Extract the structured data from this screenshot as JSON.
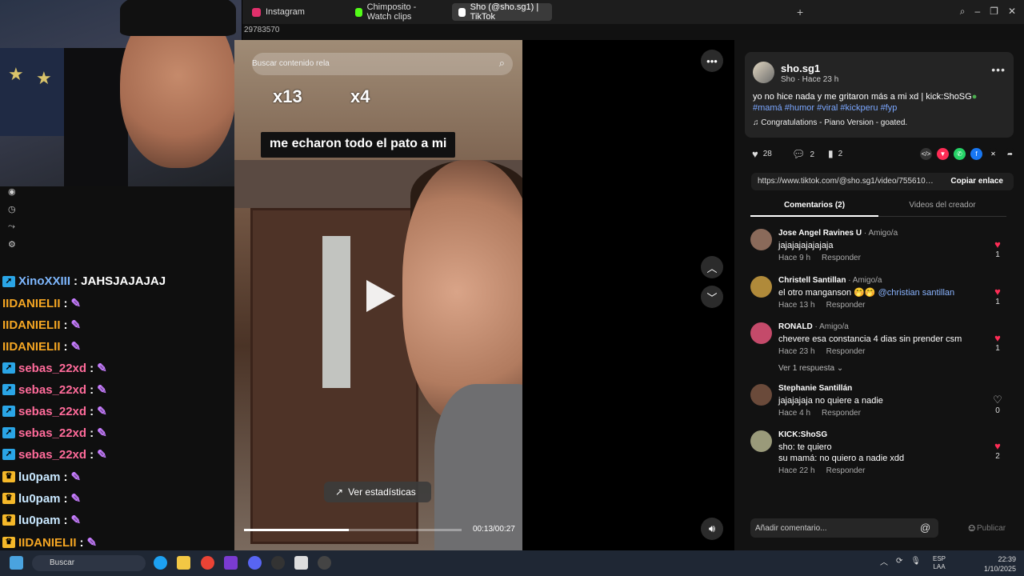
{
  "browser": {
    "tabs": [
      {
        "label": "Instagram",
        "color": "#e1306c"
      },
      {
        "label": "Chimposito - Watch clips",
        "color": "#53fc18"
      },
      {
        "label": "Sho (@sho.sg1) | TikTok",
        "color": "#ffffff"
      }
    ],
    "url_fragment": "29783570"
  },
  "chat": {
    "messages": [
      {
        "user": "XinoXXIII",
        "text": ": JAHSJAJAJAJ",
        "color": "#7fb8ff",
        "badge": "blue"
      },
      {
        "user": "IIDANIELII",
        "text": ":",
        "color": "#f5a623",
        "badge": "none"
      },
      {
        "user": "IIDANIELII",
        "text": ":",
        "color": "#f5a623",
        "badge": "none"
      },
      {
        "user": "IIDANIELII",
        "text": ":",
        "color": "#f5a623",
        "badge": "none"
      },
      {
        "user": "sebas_22xd",
        "text": ":",
        "color": "#ff6b9a",
        "badge": "blue"
      },
      {
        "user": "sebas_22xd",
        "text": ":",
        "color": "#ff6b9a",
        "badge": "blue"
      },
      {
        "user": "sebas_22xd",
        "text": ":",
        "color": "#ff6b9a",
        "badge": "blue"
      },
      {
        "user": "sebas_22xd",
        "text": ":",
        "color": "#ff6b9a",
        "badge": "blue"
      },
      {
        "user": "sebas_22xd",
        "text": ":",
        "color": "#ff6b9a",
        "badge": "blue"
      },
      {
        "user": "lu0pam",
        "text": ":",
        "color": "#c9e8ff",
        "badge": "gold"
      },
      {
        "user": "lu0pam",
        "text": ":",
        "color": "#c9e8ff",
        "badge": "gold"
      },
      {
        "user": "lu0pam",
        "text": ":",
        "color": "#c9e8ff",
        "badge": "gold"
      },
      {
        "user": "IIDANIELII",
        "text": ":",
        "color": "#f5a623",
        "badge": "gold"
      },
      {
        "user": "IIDANIELII",
        "text": "",
        "color": "#f5a623",
        "badge": "none"
      }
    ]
  },
  "video": {
    "search_placeholder": "Buscar contenido rela",
    "sticker1": "x13",
    "sticker2": "x4",
    "caption": "me echaron todo el pato a mi",
    "stats_label": "Ver estadísticas",
    "time": "00:13/00:27",
    "progress": 0.48
  },
  "post": {
    "author": "sho.sg1",
    "author_sub": "Sho · Hace 23 h",
    "description": "yo no hice nada y me gritaron más a mi xd | kick:ShoSG",
    "hashtags": "#mamá #humor #viral #kickperu #fyp",
    "music": "Congratulations - Piano Version - goated.",
    "likes": "28",
    "comments": "2",
    "saves": "2",
    "link": "https://www.tiktok.com/@sho.sg1/video/75561000...",
    "copy_label": "Copiar enlace",
    "tab_comments": "Comentarios (2)",
    "tab_videos": "Videos del creador"
  },
  "comments": [
    {
      "name": "Jose Angel Ravines U",
      "friend": " · Amigo/a",
      "text": "jajajajajajajaja",
      "mention": "",
      "time": "Hace 9 h",
      "reply": "Responder",
      "likes": "1",
      "liked": true,
      "avatar": "#8a6a5a"
    },
    {
      "name": "Christell Santillan",
      "friend": " · Amigo/a",
      "text": "el otro manganson 🤭🤭 ",
      "mention": "@christian santillan",
      "time": "Hace 13 h",
      "reply": "Responder",
      "likes": "1",
      "liked": true,
      "avatar": "#b08a3a"
    },
    {
      "name": "RONALD",
      "friend": " · Amigo/a",
      "text": "chevere esa constancia 4 dias sin prender csm",
      "mention": "",
      "time": "Hace 23 h",
      "reply": "Responder",
      "likes": "1",
      "liked": true,
      "avatar": "#c44a6a"
    },
    {
      "name": "Stephanie Santillán",
      "friend": "",
      "text": "jajajajaja no quiere a nadie",
      "mention": "",
      "time": "Hace 4 h",
      "reply": "Responder",
      "likes": "0",
      "liked": false,
      "avatar": "#6a4a3a"
    },
    {
      "name": "KICK:ShoSG",
      "friend": "",
      "text": "sho: te quiero",
      "text2": "su mamá: no quiero a nadie xdd",
      "mention": "",
      "time": "Hace 22 h",
      "reply": "Responder",
      "likes": "2",
      "liked": true,
      "avatar": "#9a9a7a"
    }
  ],
  "ver_respuesta": "Ver 1 respuesta",
  "add_comment_placeholder": "Añadir comentario...",
  "publish_label": "Publicar",
  "taskbar": {
    "search": "Buscar",
    "lang_top": "ESP",
    "lang_bottom": "LAA",
    "time": "22:39",
    "date": "1/10/2025"
  }
}
